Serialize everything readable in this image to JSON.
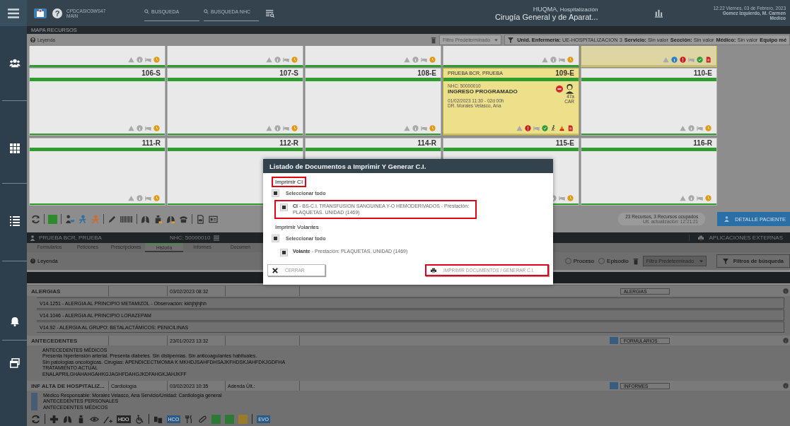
{
  "top_bar": {
    "help": "?",
    "workstation": "CPDCASIO3WS47",
    "profile": "MAIN",
    "search_fields": [
      {
        "label": "BUSQUEDA"
      },
      {
        "label": "BUSQUEDA NHC"
      }
    ],
    "hospital": "HUQMA",
    "scope": ", Hospitalización",
    "service": "Cirugía General y de Aparat...",
    "datetime": "12:22 Viernes, 03 de Febrero, 2023",
    "user": "Gomez Izquierdo, M. Carmen",
    "role": "Medico"
  },
  "resource_map": {
    "title": "MAPA RECURSOS",
    "legend": "Leyenda",
    "filter": "Filtro Predeterminado",
    "criteria": [
      {
        "label": "Unid. Enfermería:",
        "value": "UE-HOSPITALIZACION 3"
      },
      {
        "label": "Servicio:",
        "value": "Sin valor"
      },
      {
        "label": "Sección:",
        "value": "Sin valor"
      },
      {
        "label": "Médico:",
        "value": "Sin valor"
      },
      {
        "label": "Equipo mé"
      }
    ],
    "partial_row": [
      {
        "occupied": false
      },
      {
        "occupied": false
      },
      {
        "occupied": false
      },
      {
        "occupied": false
      },
      {
        "occupied": true
      }
    ],
    "rows": [
      [
        {
          "room": "106-S",
          "occupied": false
        },
        {
          "room": "107-S",
          "occupied": false
        },
        {
          "room": "108-E",
          "occupied": false
        },
        {
          "room": "109-E",
          "occupied": true,
          "patient": "PRUEBA BCR, PRUEBA",
          "nhc": "NHC: 50000010",
          "status": "INGRESO PROGRAMADO",
          "admission": "01/02/2023 11:30 - 02d 00h",
          "doctor": "DR. Morales Velasco, Ana",
          "age": "47a",
          "service": "CAR"
        },
        {
          "room": "110-E",
          "occupied": false
        }
      ],
      [
        {
          "room": "111-R",
          "occupied": false
        },
        {
          "room": "112-R",
          "occupied": false
        },
        {
          "room": "114-R",
          "occupied": false
        },
        {
          "room": "115-E",
          "occupied": false
        },
        {
          "room": "116-R",
          "occupied": false
        }
      ]
    ],
    "summary": "23 Recursos, 3 Recursos ocupados",
    "updated": "Ult. actualización: 12:21:21",
    "detail_button": "DETALLE PACIENTE"
  },
  "patient_panel": {
    "name": "PRUEBA BCR, PRUEBA",
    "nhc": "NHC: 50000010",
    "external_apps": "APLICACIONES EXTERNAS",
    "tabs": [
      {
        "label": "Formularios",
        "selected": false
      },
      {
        "label": "Peticiones",
        "selected": false
      },
      {
        "label": "Prescripciones",
        "selected": false
      },
      {
        "label": "Historia",
        "selected": true
      },
      {
        "label": "Informes",
        "selected": false
      },
      {
        "label": "Documen",
        "selected": false
      }
    ],
    "legend": "Leyenda",
    "scope_options": [
      {
        "label": "Proceso",
        "selected": false
      },
      {
        "label": "Episodio",
        "selected": false
      }
    ],
    "filter": "Filtro Predeterminado",
    "search_filters_button": "Filtros de búsqueda",
    "sections": [
      {
        "kind": "list",
        "title": "ALERGIAS",
        "date": "03/02/2023 08:32",
        "tag": "ALERGIAS",
        "new": false,
        "lines": [
          "V14.1251  -  ALERGIA AL PRINCIPIO METAMIZOL - Observación:  kkhjhjhjhh",
          "V14.1046  -  ALERGIA AL PRINCIPIO LORAZEPAM",
          "V14.92  -  ALERGIA AL GRUPO: BETALACTÁMICOS: PENICILINAS"
        ]
      },
      {
        "kind": "text",
        "title": "ANTECEDENTES",
        "date": "23/01/2023 13:32",
        "tag": "FORMULARIOS",
        "new": true,
        "lines": [
          "ANTECEDENTES MÉDICOS",
          "Presenta hipertensión arterial. Presenta diabetes. Sin dislipemias. Sin anticoagulantes habituales.",
          "Sin patologías oncológicas. Cirugías: APENDICECTMOMIA K MKHDJSAHFDHSAJKFHDSKJAHFDKJGDFHA",
          "TRATAMIENTO ACTUAL",
          "ENALAPRILGHAHAHGAHKGJAGHFDAHGJKDFAHGKJAHJKFF"
        ]
      },
      {
        "kind": "report",
        "title": "INF ALTA DE HOSPITALIZ...",
        "service": "Cardiología",
        "date": "03/02/2023 10:35",
        "addendum": "Adenda Últ.:",
        "tag": "INFORMES",
        "new": true,
        "lines": [
          "Médico Responsable: Morales Velasco, Ana   Servicio/Unidad: Cardiología general",
          "ANTECEDENTES PERSONALES",
          " ANTECEDENTES MÉDICOS"
        ]
      }
    ],
    "toolbar_tags": [
      {
        "label": "HDO"
      },
      {
        "label": "HCO"
      },
      {
        "label": "EVO"
      }
    ]
  },
  "dialog": {
    "title": "Listado de Documentos a Imprimir Y Generar C.I.",
    "groups": [
      {
        "title": "Imprimir CI",
        "highlighted": true,
        "select_all": {
          "label": "Seleccionar todo",
          "checked": true
        },
        "items": [
          {
            "text": "**CI** - BS-C.I. TRANSFUSION SANGUINEA Y-O HEMODERIVADOS - Prestación: PLAQUETAS. UNIDAD (1469)",
            "checked": true,
            "highlighted": true
          }
        ]
      },
      {
        "title": "Imprimir Volantes",
        "highlighted": false,
        "select_all": {
          "label": "Seleccionar todo",
          "checked": true
        },
        "items": [
          {
            "text": "**Volante** - Prestación: PLAQUETAS. UNIDAD (1469)",
            "checked": true,
            "highlighted": false
          }
        ]
      }
    ],
    "close_button": {
      "label": "CERRAR",
      "highlighted": false
    },
    "print_button": {
      "label": "IMPRIMIR DOCUMENTOS / GENERAR C.I.",
      "highlighted": true
    }
  }
}
